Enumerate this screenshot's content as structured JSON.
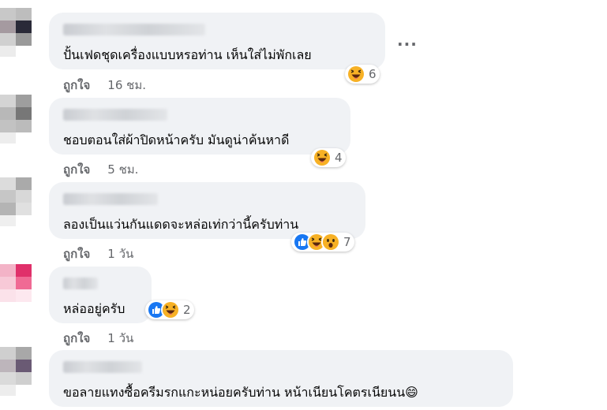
{
  "comments": [
    {
      "text": "ปั้นเฟดชุดเครื่องแบบหรอท่าน เห็นใส่ไม่พักเลย",
      "reaction_count": "6",
      "like_label": "ถูกใจ",
      "time": "16 ชม."
    },
    {
      "text": "ชอบตอนใส่ผ้าปิดหน้าครับ มันดูน่าค้นหาดี",
      "reaction_count": "4",
      "like_label": "ถูกใจ",
      "time": "5 ชม."
    },
    {
      "text": "ลองเป็นแว่นกันแดดจะหล่อเท่กว่านี้ครับท่าน",
      "reaction_count": "7",
      "like_label": "ถูกใจ",
      "time": "1 วัน"
    },
    {
      "text": "หล่ออยู่ครับ",
      "reaction_count": "2",
      "like_label": "ถูกใจ",
      "time": "1 วัน"
    },
    {
      "text": "ขอลายแทงซื้อครีมรกแกะหน่อยครับท่าน หน้าเนียนโคตรเนียนน",
      "emoji": "😄"
    }
  ],
  "more_label": "···",
  "icons": {
    "haha": "haha-reaction-icon",
    "like": "like-reaction-icon",
    "wow": "wow-reaction-icon",
    "more": "more-options-icon"
  },
  "colors": {
    "bubble": "#f0f2f5",
    "meta": "#65676b",
    "like_blue": "#1877f2",
    "haha_yellow": "#f7b125"
  }
}
